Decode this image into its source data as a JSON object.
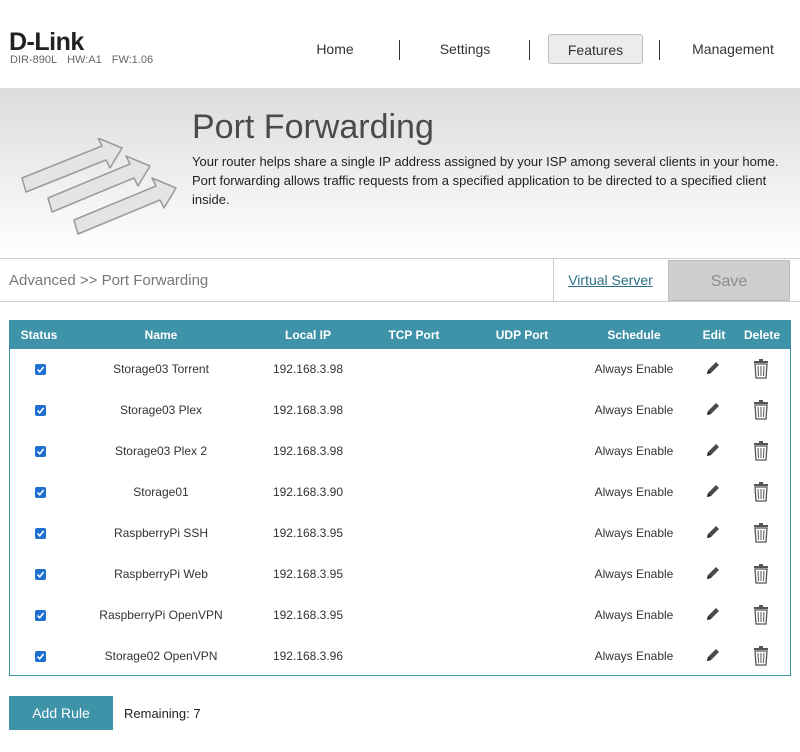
{
  "header": {
    "logo": "D-Link",
    "model": "DIR-890L",
    "hw": "HW:A1",
    "fw": "FW:1.06",
    "nav": [
      {
        "label": "Home",
        "active": false
      },
      {
        "label": "Settings",
        "active": false
      },
      {
        "label": "Features",
        "active": true
      },
      {
        "label": "Management",
        "active": false
      }
    ]
  },
  "banner": {
    "title": "Port Forwarding",
    "description": "Your router helps share a single IP address assigned by your ISP among several clients in your home. Port forwarding allows traffic requests from a specified application to be directed to a specified client inside."
  },
  "breadcrumb": {
    "path": "Advanced >> Port Forwarding",
    "virtual_server_link": "Virtual Server",
    "save_label": "Save"
  },
  "table": {
    "columns": [
      "Status",
      "Name",
      "Local IP",
      "TCP Port",
      "UDP Port",
      "Schedule",
      "Edit",
      "Delete"
    ],
    "rows": [
      {
        "checked": true,
        "name": "Storage03 Torrent",
        "ip": "192.168.3.98",
        "tcp": "",
        "udp": "",
        "schedule": "Always Enable"
      },
      {
        "checked": true,
        "name": "Storage03 Plex",
        "ip": "192.168.3.98",
        "tcp": "",
        "udp": "",
        "schedule": "Always Enable"
      },
      {
        "checked": true,
        "name": "Storage03 Plex 2",
        "ip": "192.168.3.98",
        "tcp": "",
        "udp": "",
        "schedule": "Always Enable"
      },
      {
        "checked": true,
        "name": "Storage01",
        "ip": "192.168.3.90",
        "tcp": "",
        "udp": "",
        "schedule": "Always Enable"
      },
      {
        "checked": true,
        "name": "RaspberryPi SSH",
        "ip": "192.168.3.95",
        "tcp": "",
        "udp": "",
        "schedule": "Always Enable"
      },
      {
        "checked": true,
        "name": "RaspberryPi Web",
        "ip": "192.168.3.95",
        "tcp": "",
        "udp": "",
        "schedule": "Always Enable"
      },
      {
        "checked": true,
        "name": "RaspberryPi OpenVPN",
        "ip": "192.168.3.95",
        "tcp": "",
        "udp": "",
        "schedule": "Always Enable"
      },
      {
        "checked": true,
        "name": "Storage02 OpenVPN",
        "ip": "192.168.3.96",
        "tcp": "",
        "udp": "",
        "schedule": "Always Enable"
      }
    ]
  },
  "footer": {
    "add_rule_label": "Add Rule",
    "remaining": "Remaining: 7"
  },
  "colors": {
    "accent": "#3f93a9",
    "checkbox": "#1f6fd1",
    "link": "#2b6f86"
  },
  "icons": {
    "edit": "pencil-icon",
    "delete": "trash-icon",
    "banner": "port-forwarding-arrows-icon"
  }
}
